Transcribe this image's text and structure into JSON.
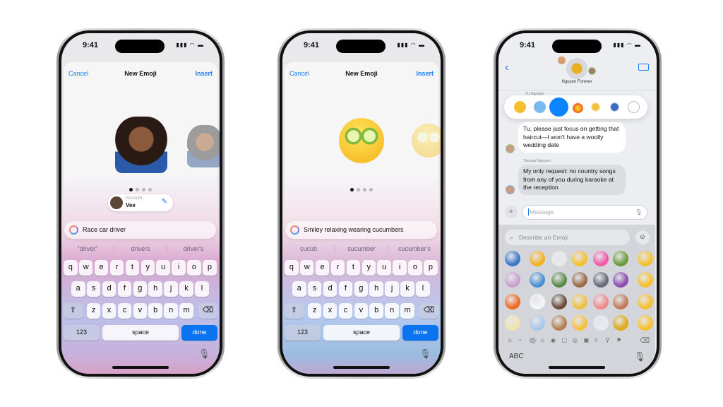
{
  "status": {
    "time": "9:41"
  },
  "phone1": {
    "cancel": "Cancel",
    "title": "New Emoji",
    "insert": "Insert",
    "person_label": "PERSON",
    "person_name": "Vee",
    "prompt": "Race car driver",
    "suggestions": [
      "\"driver\"",
      "drivers",
      "driver's"
    ],
    "page_dots": {
      "count": 4,
      "active": 1
    }
  },
  "phone2": {
    "cancel": "Cancel",
    "title": "New Emoji",
    "insert": "Insert",
    "prompt": "Smiley relaxing wearing cucumbers",
    "suggestions": [
      "cucub",
      "cucumber",
      "cucumber's"
    ],
    "page_dots": {
      "count": 4,
      "active": 1
    }
  },
  "keyboard": {
    "rows": [
      [
        "q",
        "w",
        "e",
        "r",
        "t",
        "y",
        "u",
        "i",
        "o",
        "p"
      ],
      [
        "a",
        "s",
        "d",
        "f",
        "g",
        "h",
        "j",
        "k",
        "l"
      ],
      [
        "z",
        "x",
        "c",
        "v",
        "b",
        "n",
        "m"
      ]
    ],
    "numbers": "123",
    "space": "space",
    "done": "done"
  },
  "phone3": {
    "group_name": "Nguyen Forever",
    "sender1": "Tu Nguyen",
    "message1": "Tu, please just focus on getting that haircut—I won't have a woolly wedding date",
    "sender2": "Tamara Nguyen",
    "message2": "My only request: no country songs from any of you during karaoke at the reception",
    "message_placeholder": "Message",
    "search_placeholder": "Describe an Emoji",
    "abc": "ABC",
    "reactions": [
      "sunglasses-face",
      "cold-face",
      "spy-genmoji",
      "fire",
      "victory-hand",
      "shrug-genmoji",
      "add-sticker"
    ],
    "emoji_grid": [
      [
        "dragon",
        "weary-face",
        "spy-sheep",
        "smirk-face",
        "hearts",
        "cactus-face",
        "grin"
      ],
      [
        "bubble-tea",
        "frog-snowboard",
        "duck",
        "cowboy-boots",
        "dog-armor",
        "woman-heart-gesture",
        "grin"
      ],
      [
        "traffic-cone",
        "ghost",
        "man-gray-hat",
        "person-laptop",
        "cake",
        "woman-curly-hair",
        "grin"
      ],
      [
        "face-mask",
        "wind",
        "monkey",
        "thumbs-up",
        "astronaut",
        "trophy",
        "grin"
      ]
    ]
  },
  "colors": {
    "accent": "#1a7cf2",
    "done": "#0a74f0"
  }
}
